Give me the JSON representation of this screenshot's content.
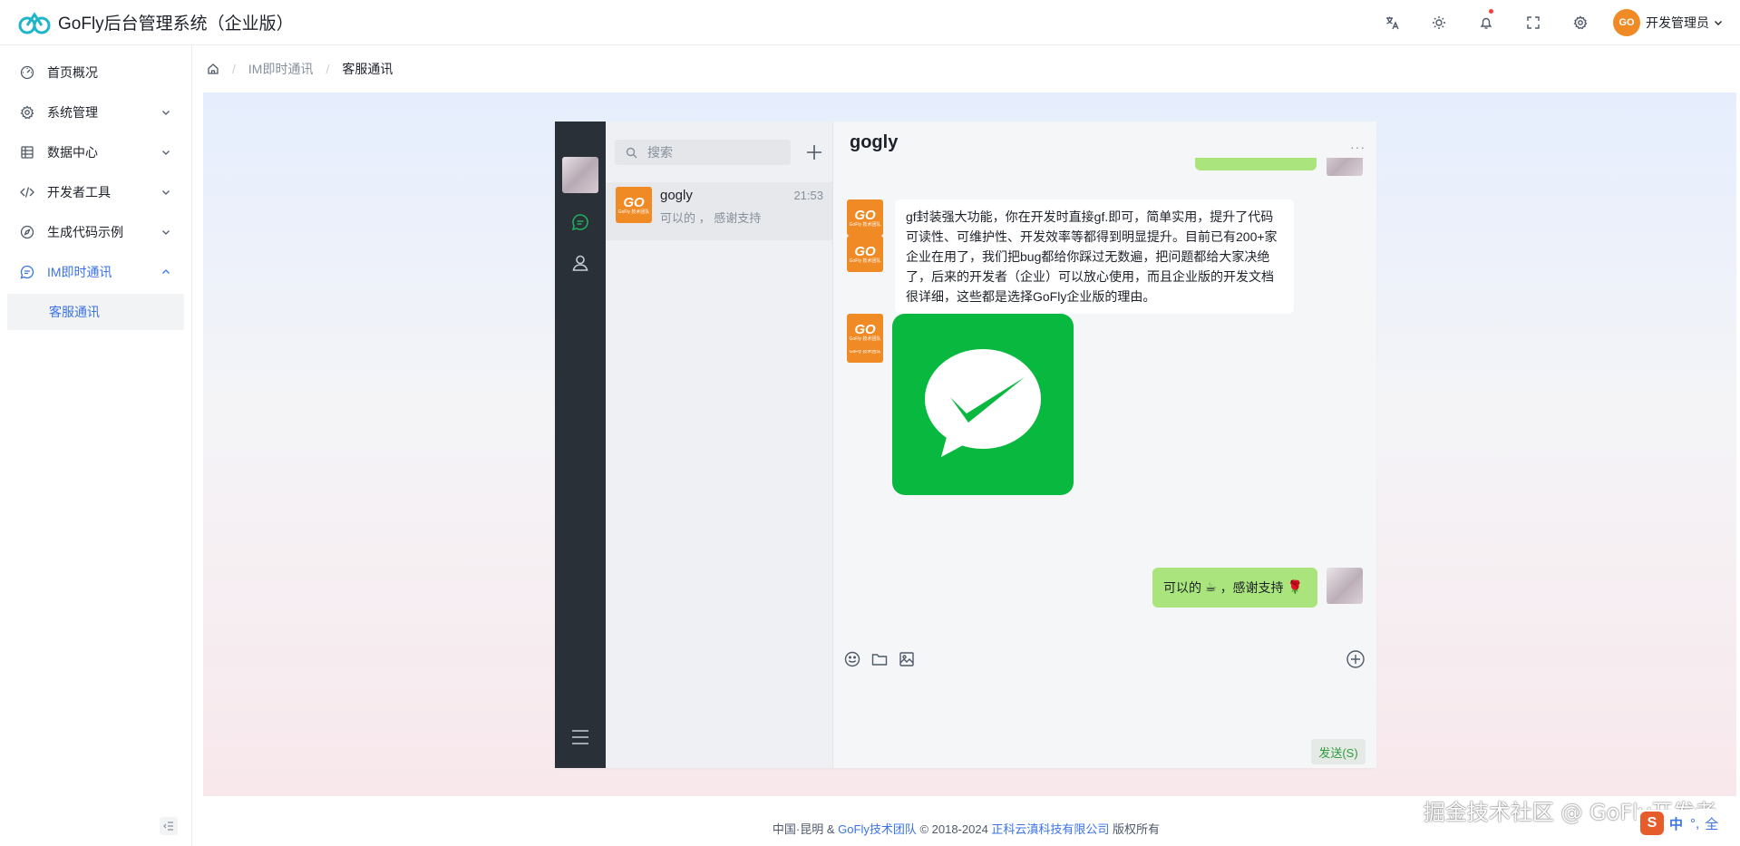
{
  "app": {
    "title": "GoFly后台管理系统（企业版）",
    "user_name": "开发管理员",
    "avatar_text": "GO"
  },
  "header_icons": [
    "translate-icon",
    "theme-sun-icon",
    "notification-bell-icon",
    "fullscreen-icon",
    "settings-icon"
  ],
  "sidebar": {
    "items": [
      {
        "label": "首页概况",
        "icon": "dashboard-icon"
      },
      {
        "label": "系统管理",
        "icon": "gear-icon"
      },
      {
        "label": "数据中心",
        "icon": "database-icon"
      },
      {
        "label": "开发者工具",
        "icon": "code-icon"
      },
      {
        "label": "生成代码示例",
        "icon": "compass-icon"
      },
      {
        "label": "IM即时通讯",
        "icon": "chat-icon"
      }
    ],
    "active_sub": "客服通讯"
  },
  "breadcrumb": [
    "IM即时通讯",
    "客服通讯"
  ],
  "chat": {
    "search_placeholder": "搜索",
    "conversation": {
      "name": "gogly",
      "time": "21:53",
      "preview": "可以的 ， 感谢支持"
    },
    "peer_name": "gogly",
    "more": "···",
    "avatar_go": "GO",
    "avatar_go_sub": "GoFly 技术团队",
    "messages": {
      "long_text": "gf封装强大功能，你在开发时直接gf.即可，简单实用，提升了代码可读性、可维护性、开发效率等都得到明显提升。目前已有200+家企业在用了，我们把bug都给你踩过无数遍，把问题都给大家决绝了，后来的开发者（企业）可以放心使用，而且企业版的开发文档很详细，这些都是选择GoFly企业版的理由。",
      "reply_text_1": "可以的",
      "reply_emoji_1": "☕",
      "reply_text_2": "，感谢支持",
      "reply_emoji_2": "🌹"
    },
    "send_label": "发送(S)"
  },
  "footer": {
    "prefix": "中国·昆明 & ",
    "team": "GoFly技术团队",
    "copy": " © 2018-2024 ",
    "company": "正科云滇科技有限公司",
    "suffix": " 版权所有"
  },
  "watermark": "掘金技术社区 @ GoFly开发者",
  "ime": {
    "logo": "S",
    "mode": "中",
    "punct": "°,",
    "width": "全"
  },
  "colors": {
    "accent": "#3b73e6",
    "rail": "#2a3038",
    "bubble_green": "#a9e57c",
    "wechat_green": "#09b83e",
    "go_orange": "#f08a24"
  }
}
